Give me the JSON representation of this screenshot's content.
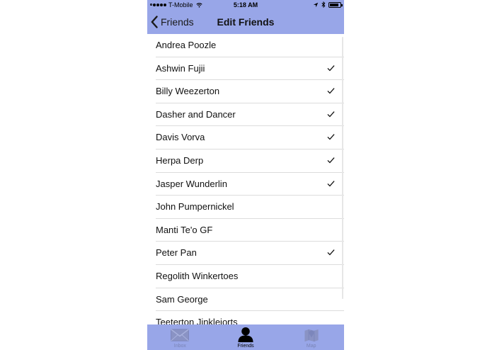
{
  "status_bar": {
    "carrier": "T-Mobile",
    "time": "5:18 AM"
  },
  "nav": {
    "back_label": "Friends",
    "title": "Edit Friends"
  },
  "friends": [
    {
      "name": "Andrea Poozle",
      "checked": false
    },
    {
      "name": "Ashwin Fujii",
      "checked": true
    },
    {
      "name": "Billy Weezerton",
      "checked": true
    },
    {
      "name": "Dasher and Dancer",
      "checked": true
    },
    {
      "name": "Davis Vorva",
      "checked": true
    },
    {
      "name": "Herpa Derp",
      "checked": true
    },
    {
      "name": "Jasper Wunderlin",
      "checked": true
    },
    {
      "name": "John Pumpernickel",
      "checked": false
    },
    {
      "name": "Manti Te'o GF",
      "checked": false
    },
    {
      "name": "Peter Pan",
      "checked": true
    },
    {
      "name": "Regolith Winkertoes",
      "checked": false
    },
    {
      "name": "Sam George",
      "checked": false
    },
    {
      "name": "Teeterton Jinkleiorts",
      "checked": false
    }
  ],
  "tabs": [
    {
      "label": "Inbox",
      "icon": "envelope-icon",
      "active": false
    },
    {
      "label": "Friends",
      "icon": "person-icon",
      "active": true
    },
    {
      "label": "Map",
      "icon": "map-icon",
      "active": false
    }
  ],
  "colors": {
    "bar_background": "#98a6e8",
    "separator": "#dcdcdc"
  }
}
